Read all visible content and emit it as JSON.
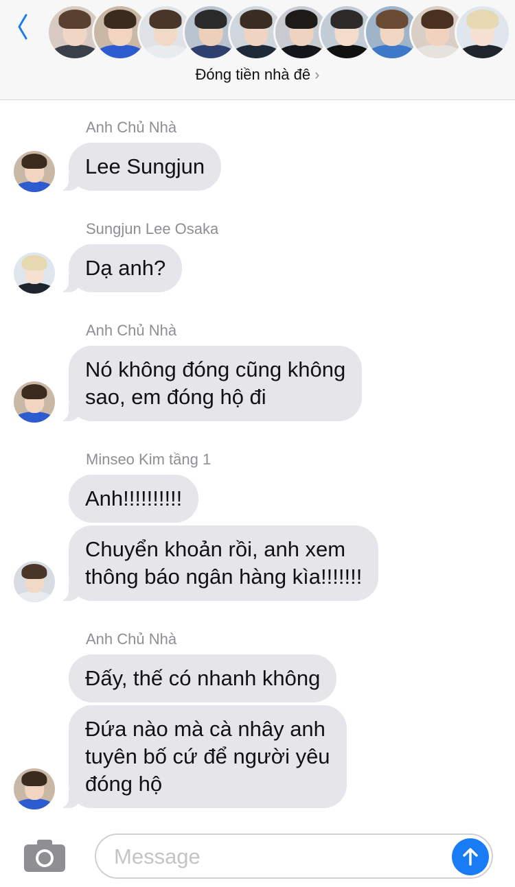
{
  "header": {
    "group_name": "Đóng tiền nhà đê",
    "chevron": "›",
    "back_icon": "chevron-left-icon",
    "accent": "#1a7cf5"
  },
  "messages": [
    {
      "sender": "Anh Chủ Nhà",
      "bubbles": [
        "Lee Sungjun"
      ]
    },
    {
      "sender": "Sungjun Lee Osaka",
      "bubbles": [
        "Dạ anh?"
      ]
    },
    {
      "sender": "Anh Chủ Nhà",
      "bubbles": [
        "Nó không đóng cũng không\nsao, em đóng hộ đi"
      ]
    },
    {
      "sender": "Minseo Kim tầng 1",
      "bubbles": [
        "Anh!!!!!!!!!!",
        "Chuyển khoản rồi, anh xem\nthông báo ngân hàng kìa!!!!!!!"
      ]
    },
    {
      "sender": "Anh Chủ Nhà",
      "bubbles": [
        "Đấy, thế có nhanh không",
        "Đứa nào mà cà nhây anh\ntuyên bố cứ để người yêu\nđóng hộ"
      ]
    }
  ],
  "composer": {
    "placeholder": "Message",
    "camera_icon": "camera-icon",
    "send_icon": "send-arrow-icon"
  },
  "colors": {
    "bubble": "#e5e5ea",
    "sender_text": "#8e8e93",
    "send_button": "#1a7cf5"
  }
}
